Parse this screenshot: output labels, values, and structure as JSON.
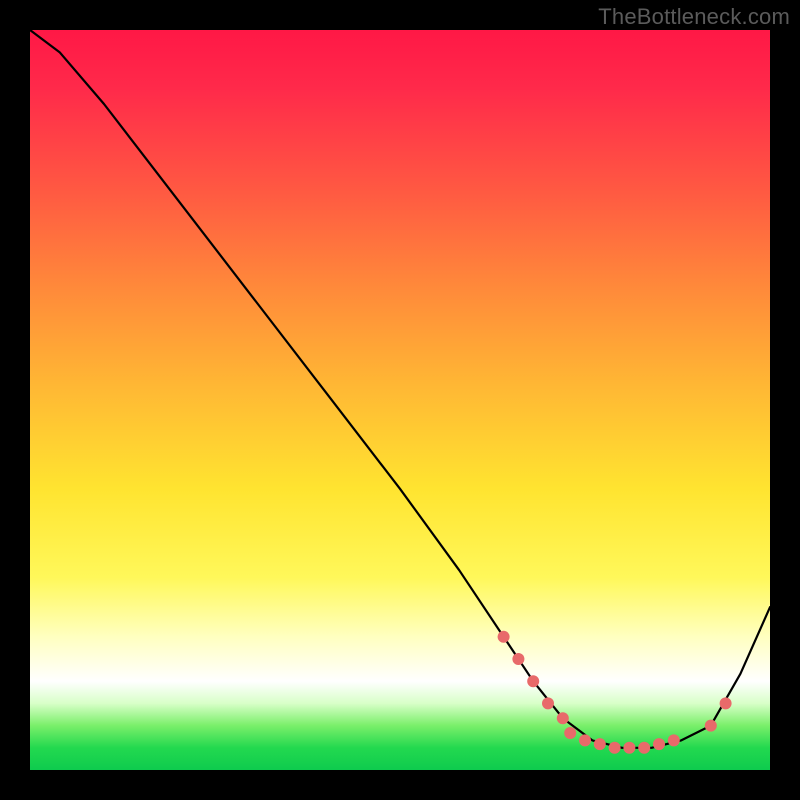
{
  "watermark": "TheBottleneck.com",
  "chart_data": {
    "type": "line",
    "title": "",
    "xlabel": "",
    "ylabel": "",
    "xlim": [
      0,
      100
    ],
    "ylim": [
      0,
      100
    ],
    "grid": false,
    "legend": false,
    "colors": {
      "curve": "#000000",
      "markers": "#e86a6a"
    },
    "series": [
      {
        "name": "curve",
        "x": [
          0,
          4,
          10,
          20,
          30,
          40,
          50,
          58,
          64,
          68,
          72,
          76,
          80,
          84,
          88,
          92,
          96,
          100
        ],
        "y": [
          100,
          97,
          90,
          77,
          64,
          51,
          38,
          27,
          18,
          12,
          7,
          4,
          3,
          3,
          4,
          6,
          13,
          22
        ]
      }
    ],
    "markers": [
      {
        "x": 64,
        "y": 18
      },
      {
        "x": 66,
        "y": 15
      },
      {
        "x": 68,
        "y": 12
      },
      {
        "x": 70,
        "y": 9
      },
      {
        "x": 72,
        "y": 7
      },
      {
        "x": 73,
        "y": 5
      },
      {
        "x": 75,
        "y": 4
      },
      {
        "x": 77,
        "y": 3.5
      },
      {
        "x": 79,
        "y": 3
      },
      {
        "x": 81,
        "y": 3
      },
      {
        "x": 83,
        "y": 3
      },
      {
        "x": 85,
        "y": 3.5
      },
      {
        "x": 87,
        "y": 4
      },
      {
        "x": 92,
        "y": 6
      },
      {
        "x": 94,
        "y": 9
      }
    ]
  }
}
